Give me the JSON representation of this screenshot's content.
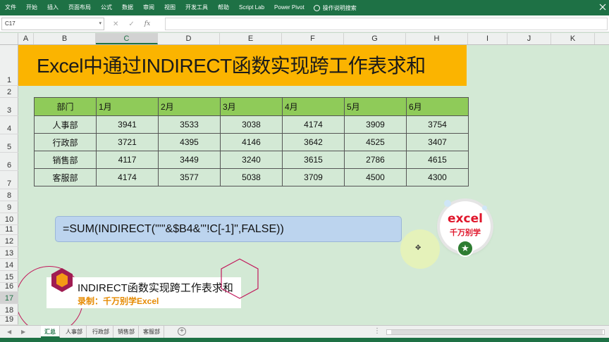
{
  "ribbon": {
    "tabs": [
      "文件",
      "开始",
      "插入",
      "页面布局",
      "公式",
      "数据",
      "审阅",
      "视图",
      "开发工具",
      "帮助",
      "Script Lab",
      "Power Pivot"
    ],
    "tell_me": "操作说明搜索"
  },
  "formula_bar": {
    "name_box": "C17",
    "cancel_glyph": "✕",
    "enter_glyph": "✓",
    "fx_glyph": "fx",
    "formula": ""
  },
  "columns": [
    "A",
    "B",
    "C",
    "D",
    "E",
    "F",
    "G",
    "H",
    "I",
    "J",
    "K"
  ],
  "rows": [
    "1",
    "2",
    "3",
    "4",
    "5",
    "6",
    "7",
    "8",
    "9",
    "10",
    "11",
    "12",
    "13",
    "14",
    "15",
    "16",
    "17",
    "18",
    "19"
  ],
  "selected_cell": {
    "column": "C",
    "row": "17"
  },
  "banner": {
    "title": "Excel中通过INDIRECT函数实现跨工作表求和"
  },
  "table": {
    "headers": [
      "部门",
      "1月",
      "2月",
      "3月",
      "4月",
      "5月",
      "6月"
    ],
    "rows": [
      [
        "人事部",
        "3941",
        "3533",
        "3038",
        "4174",
        "3909",
        "3754"
      ],
      [
        "行政部",
        "3721",
        "4395",
        "4146",
        "3642",
        "4525",
        "3407"
      ],
      [
        "销售部",
        "4117",
        "3449",
        "3240",
        "3615",
        "2786",
        "4615"
      ],
      [
        "客服部",
        "4174",
        "3577",
        "5038",
        "3709",
        "4500",
        "4300"
      ]
    ]
  },
  "callout": {
    "formula": "=SUM(INDIRECT(\"'\"&$B4&\"'!C[-1]\",FALSE))"
  },
  "logo": {
    "line1": "excel",
    "line2": "千万别学",
    "star": "★"
  },
  "lower_third": {
    "title": "INDIRECT函数实现跨工作表求和",
    "subtitle": "录制：千万别学Excel"
  },
  "sheets": {
    "tabs": [
      "汇总",
      "人事部",
      "行政部",
      "销售部",
      "客服部"
    ],
    "active": "汇总",
    "add_glyph": "+",
    "more_glyph": "⋮"
  },
  "colors": {
    "ribbon": "#1e7145",
    "banner": "#fbb400",
    "table_header": "#8fcb59",
    "callout": "#bcd4ee",
    "sheet_bg": "#d3e9d5"
  }
}
